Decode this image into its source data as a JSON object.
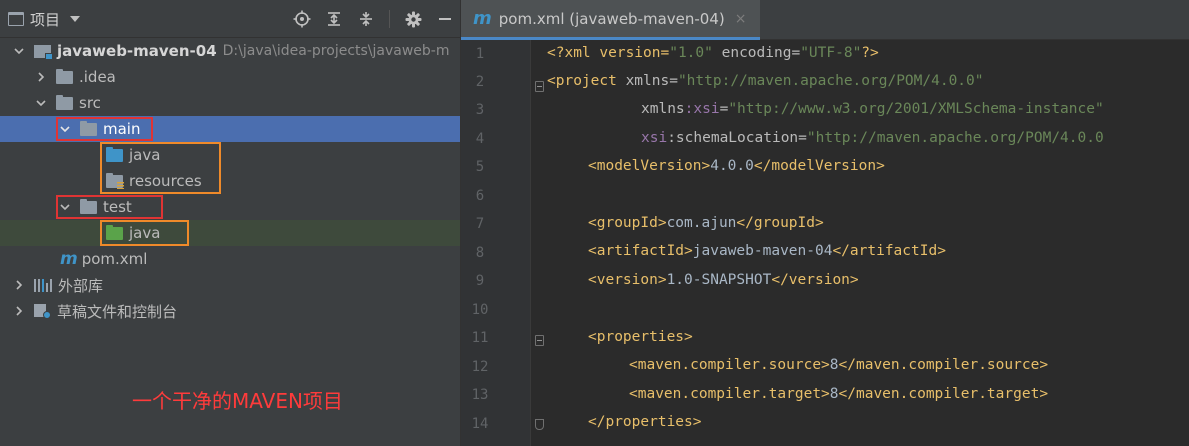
{
  "project_panel": {
    "title": "项目",
    "tree": [
      {
        "label": "javaweb-maven-04",
        "path": "D:\\java\\idea-projects\\javaweb-m"
      },
      {
        "label": ".idea"
      },
      {
        "label": "src"
      },
      {
        "label": "main"
      },
      {
        "label": "java"
      },
      {
        "label": "resources"
      },
      {
        "label": "test"
      },
      {
        "label": "java"
      },
      {
        "label": "pom.xml"
      },
      {
        "label": "外部库"
      },
      {
        "label": "草稿文件和控制台"
      }
    ],
    "caption": "一个干净的MAVEN项目"
  },
  "editor": {
    "tab": {
      "label": "pom.xml (javaweb-maven-04)",
      "close": "×"
    },
    "line_numbers": [
      "1",
      "2",
      "3",
      "4",
      "5",
      "6",
      "7",
      "8",
      "9",
      "10",
      "11",
      "12",
      "13",
      "14"
    ],
    "code": {
      "l1": [
        "<?xml version=",
        "\"1.0\"",
        " encoding=",
        "\"UTF-8\"",
        "?>"
      ],
      "l2": [
        "<project",
        " xmlns=",
        "\"http://maven.apache.org/POM/4.0.0\""
      ],
      "l3": [
        "xmlns",
        ":xsi",
        "=",
        "\"http://www.w3.org/2001/XMLSchema-instance\""
      ],
      "l4": [
        "xsi",
        ":schemaLocation",
        "=",
        "\"http://maven.apache.org/POM/4.0.0"
      ],
      "l5": [
        "<modelVersion>",
        "4.0.0",
        "</modelVersion>"
      ],
      "l7": [
        "<groupId>",
        "com.ajun",
        "</groupId>"
      ],
      "l8": [
        "<artifactId>",
        "javaweb-maven-04",
        "</artifactId>"
      ],
      "l9": [
        "<version>",
        "1.0-SNAPSHOT",
        "</version>"
      ],
      "l11": [
        "<properties>"
      ],
      "l12": [
        "<maven.compiler.source>",
        "8",
        "</maven.compiler.source>"
      ],
      "l13": [
        "<maven.compiler.target>",
        "8",
        "</maven.compiler.target>"
      ],
      "l14": [
        "</properties>"
      ]
    }
  },
  "colors": {
    "selection": "#4b6eaf",
    "highlight_red": "#e03434",
    "highlight_orange": "#ef8a2a",
    "caption_red": "#ff3b3b",
    "xml_tag": "#e8bf6a",
    "xml_string": "#6a8759"
  },
  "icons": {
    "header": [
      "window-icon",
      "locate-icon",
      "expand-all-icon",
      "collapse-all-icon",
      "gear-icon",
      "minimize-icon"
    ],
    "tree": [
      "project-folder-icon",
      "folder-icon",
      "source-folder-icon",
      "resources-folder-icon",
      "test-folder-icon",
      "maven-icon",
      "library-icon",
      "scratch-icon"
    ]
  }
}
